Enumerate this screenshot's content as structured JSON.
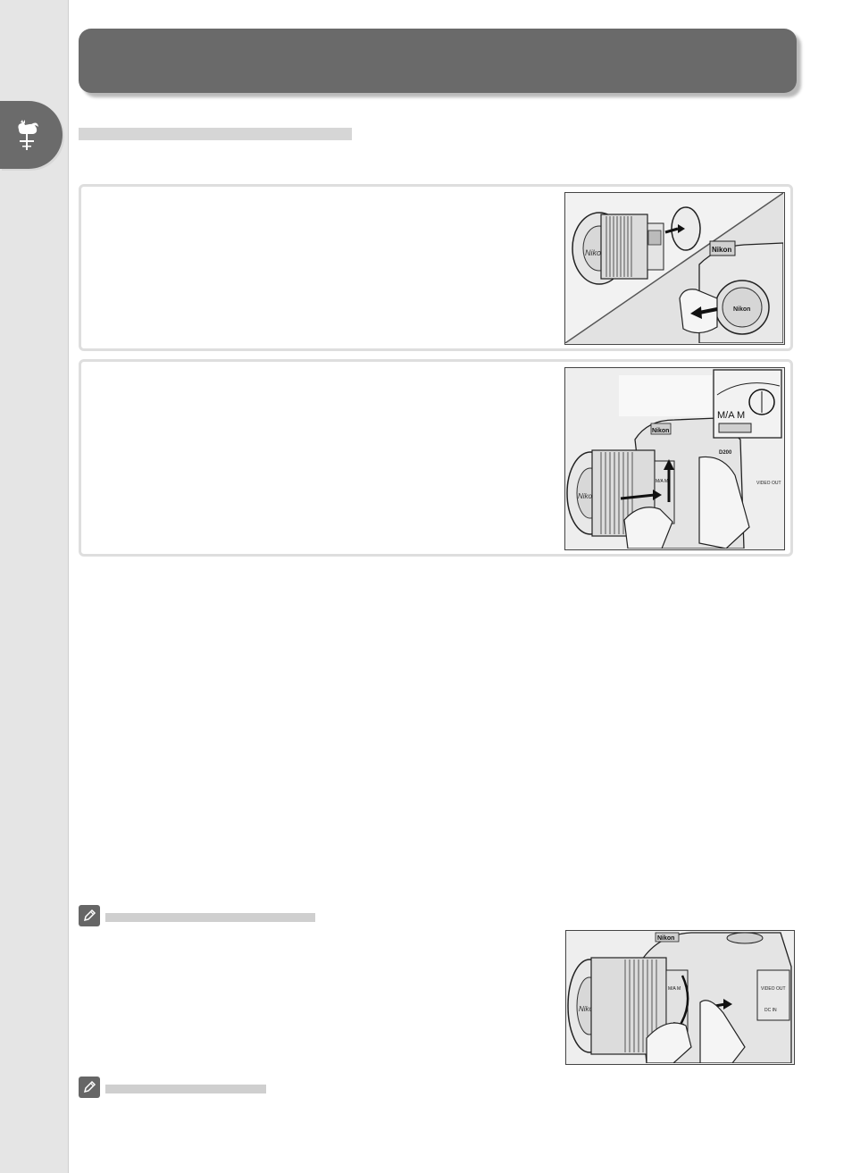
{
  "page": {
    "chapter_tab": {
      "icon": "weathervane-rooster-icon"
    },
    "title_banner": {
      "text": ""
    },
    "section_heading": {
      "text": ""
    },
    "steps": [
      {
        "text": "",
        "illustration": "lens-and-body-cap-removal"
      },
      {
        "text": "",
        "illustration": "lens-mounting-on-camera"
      }
    ],
    "notes": [
      {
        "icon": "pencil-note-icon",
        "heading": "",
        "illustration": "lens-release-button"
      },
      {
        "icon": "pencil-note-icon",
        "heading": ""
      }
    ]
  },
  "illustration_labels": {
    "brand": "Nikon",
    "model": "D200",
    "switch": "M/A  M",
    "mode_marks": "M/A  M",
    "video": "VIDEO OUT",
    "dc": "DC IN"
  },
  "colors": {
    "banner": "#6a6a6a",
    "side_band": "#e5e5e5",
    "placeholder_bar": "#d6d6d6",
    "box_border": "#dedede"
  }
}
